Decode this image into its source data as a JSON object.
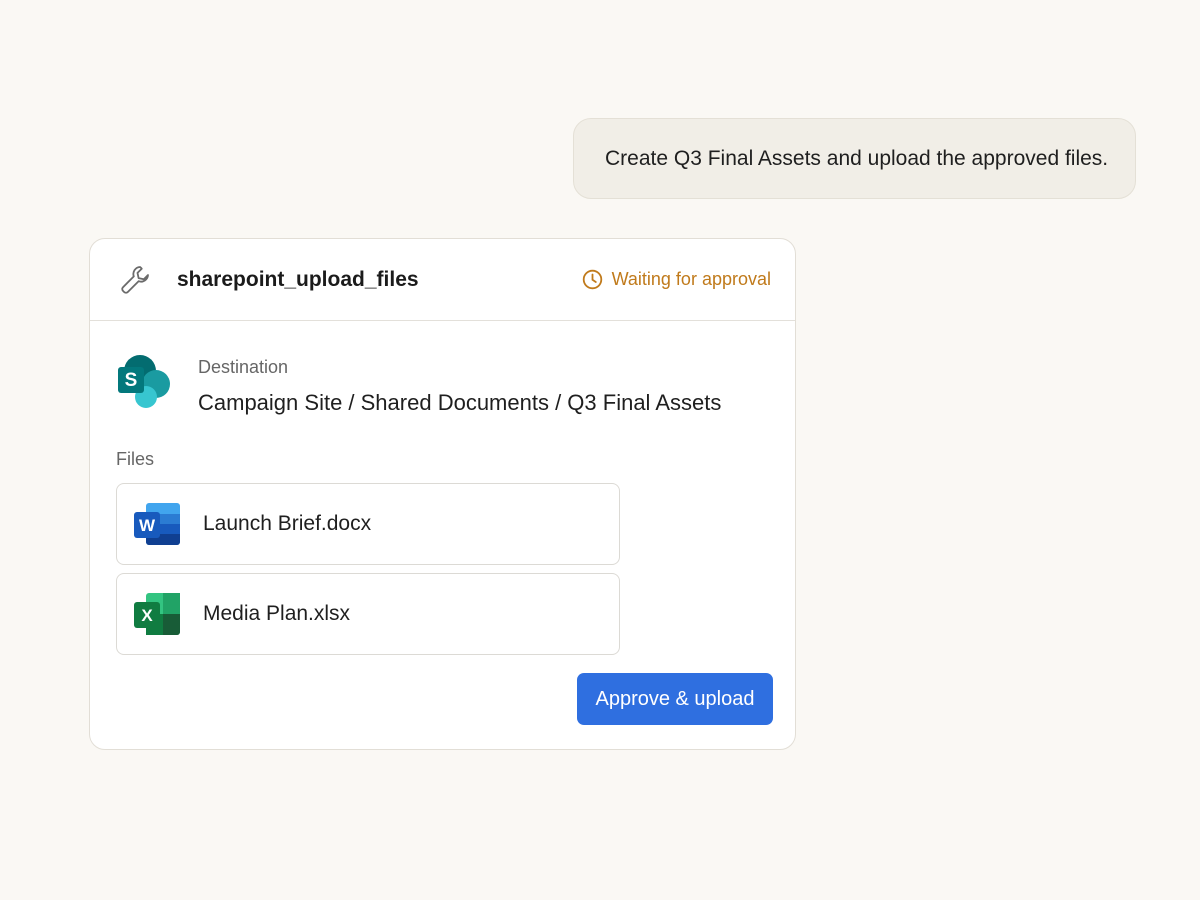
{
  "chat": {
    "user_message": "Create Q3 Final Assets and upload the approved files."
  },
  "tool_card": {
    "tool_name": "sharepoint_upload_files",
    "tool_icon": "wrench-icon",
    "status": {
      "text": "Waiting for approval",
      "icon": "clock-icon",
      "color": "#c07a1b"
    },
    "destination": {
      "label": "Destination",
      "path": "Campaign Site / Shared Documents / Q3 Final Assets",
      "icon": "sharepoint-icon",
      "icon_letter": "S"
    },
    "files": {
      "label": "Files",
      "items": [
        {
          "name": "Launch Brief.docx",
          "icon": "word-icon",
          "icon_letter": "W"
        },
        {
          "name": "Media Plan.xlsx",
          "icon": "excel-icon",
          "icon_letter": "X"
        }
      ]
    },
    "approve_button": {
      "label": "Approve & upload",
      "color": "#2f6fe0"
    }
  }
}
